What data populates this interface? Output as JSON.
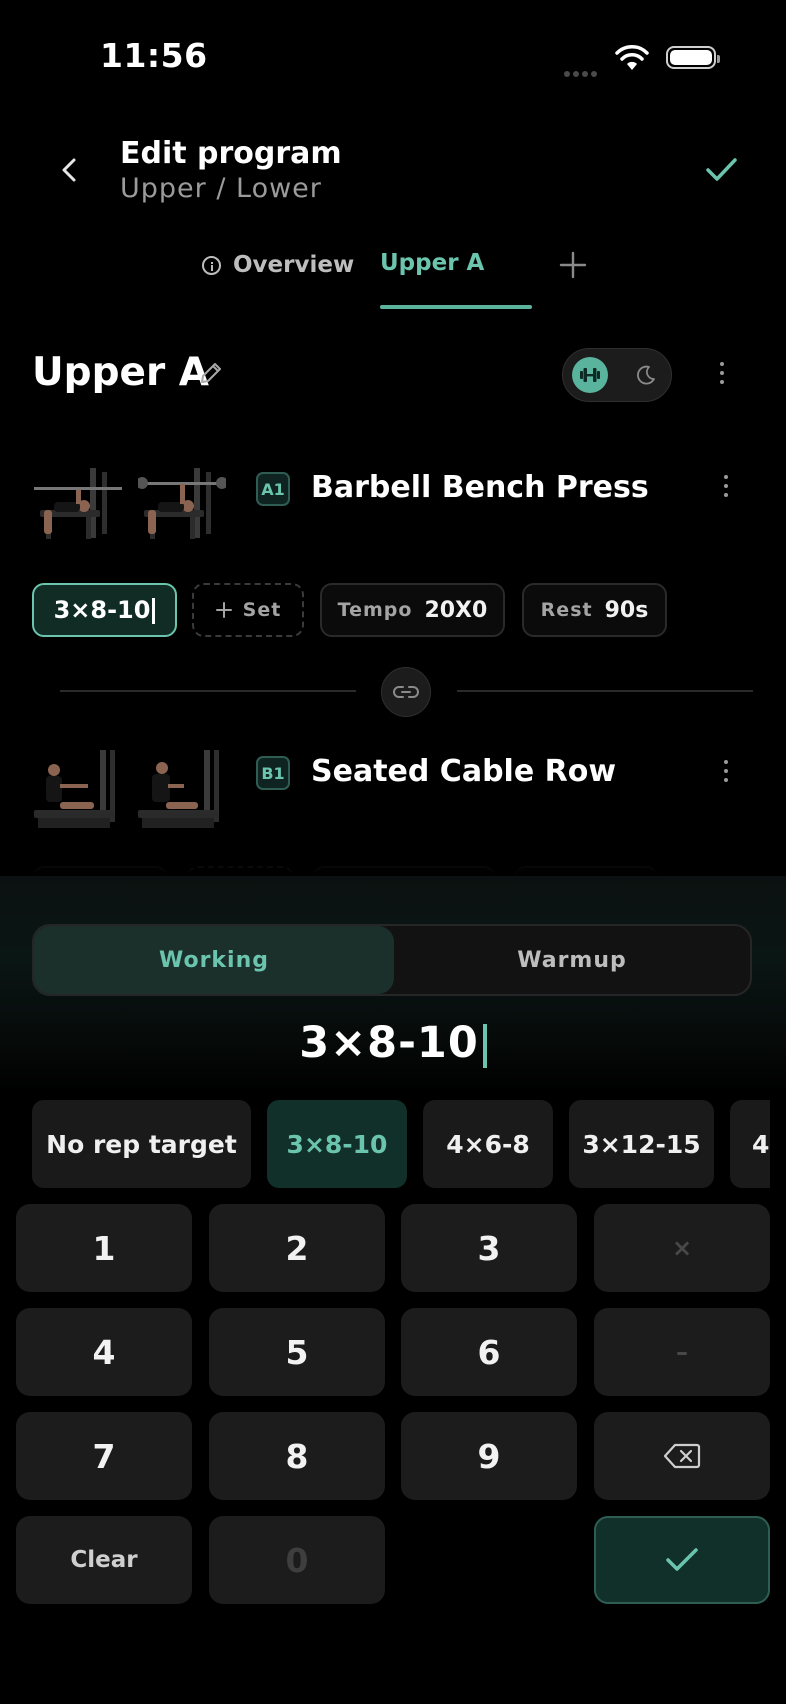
{
  "status": {
    "time": "11:56"
  },
  "header": {
    "title": "Edit program",
    "subtitle": "Upper / Lower"
  },
  "tabs": [
    {
      "label": "Overview",
      "active": false
    },
    {
      "label": "Upper A",
      "active": true
    }
  ],
  "section": {
    "title": "Upper A"
  },
  "exercises": [
    {
      "badge": "A1",
      "name": "Barbell Bench Press",
      "chips": {
        "sets": "3×8-10",
        "add_set": "Set",
        "tempo_key": "Tempo",
        "tempo_val": "20X0",
        "rest_key": "Rest",
        "rest_val": "90s"
      }
    },
    {
      "badge": "B1",
      "name": "Seated Cable Row"
    }
  ],
  "keyboard": {
    "segments": {
      "working": "Working",
      "warmup": "Warmup",
      "selected": "Working"
    },
    "value": "3×8-10",
    "presets": [
      "No rep target",
      "3×8-10",
      "4×6-8",
      "3×12-15",
      "4"
    ],
    "selected_preset": "3×8-10",
    "keys": {
      "k1": "1",
      "k2": "2",
      "k3": "3",
      "times": "×",
      "k4": "4",
      "k5": "5",
      "k6": "6",
      "dash": "–",
      "k7": "7",
      "k8": "8",
      "k9": "9",
      "clear": "Clear",
      "k0": "0"
    }
  },
  "colors": {
    "accent": "#6bc4ad",
    "accent_dark": "#12302a",
    "background": "#000000",
    "surface": "#1c1c1c"
  }
}
